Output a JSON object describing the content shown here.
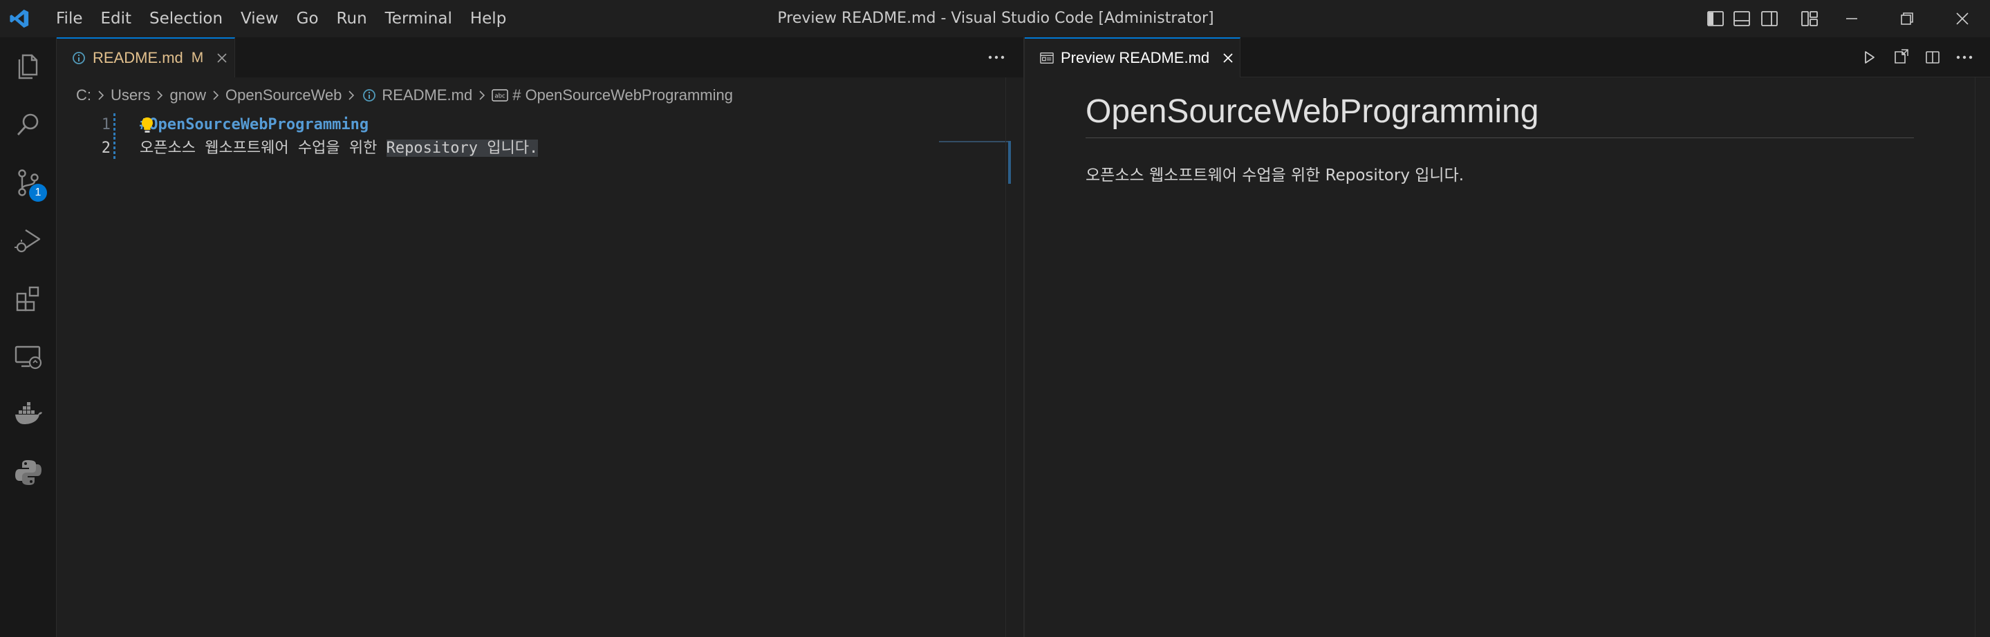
{
  "window": {
    "title": "Preview README.md - Visual Studio Code [Administrator]"
  },
  "menu": [
    "File",
    "Edit",
    "Selection",
    "View",
    "Go",
    "Run",
    "Terminal",
    "Help"
  ],
  "activity_bar": {
    "items": [
      "explorer-icon",
      "search-icon",
      "source-control-icon",
      "run-debug-icon",
      "extensions-icon",
      "remote-explorer-icon",
      "docker-icon",
      "python-icon"
    ],
    "source_control_badge": "1"
  },
  "left_editor": {
    "tab": {
      "label": "README.md",
      "status": "M"
    },
    "breadcrumb": [
      "C:",
      "Users",
      "gnow",
      "OpenSourceWeb",
      "README.md",
      "# OpenSourceWebProgramming"
    ],
    "lines": [
      {
        "number": "1",
        "prefix": "#",
        "text": "OpenSourceWebProgramming"
      },
      {
        "number": "2",
        "plain": "오픈소스 웹소프트웨어 수업을 위한 ",
        "selected": "Repository 입니다."
      }
    ]
  },
  "right_editor": {
    "tab": {
      "label": "Preview README.md"
    },
    "preview": {
      "heading": "OpenSourceWebProgramming",
      "paragraph": "오픈소스 웹소프트웨어 수업을 위한 Repository 입니다."
    }
  },
  "colors": {
    "accent": "#0078d4",
    "modified": "#e2c08d",
    "heading": "#569cd6",
    "background": "#1f1f1f"
  }
}
